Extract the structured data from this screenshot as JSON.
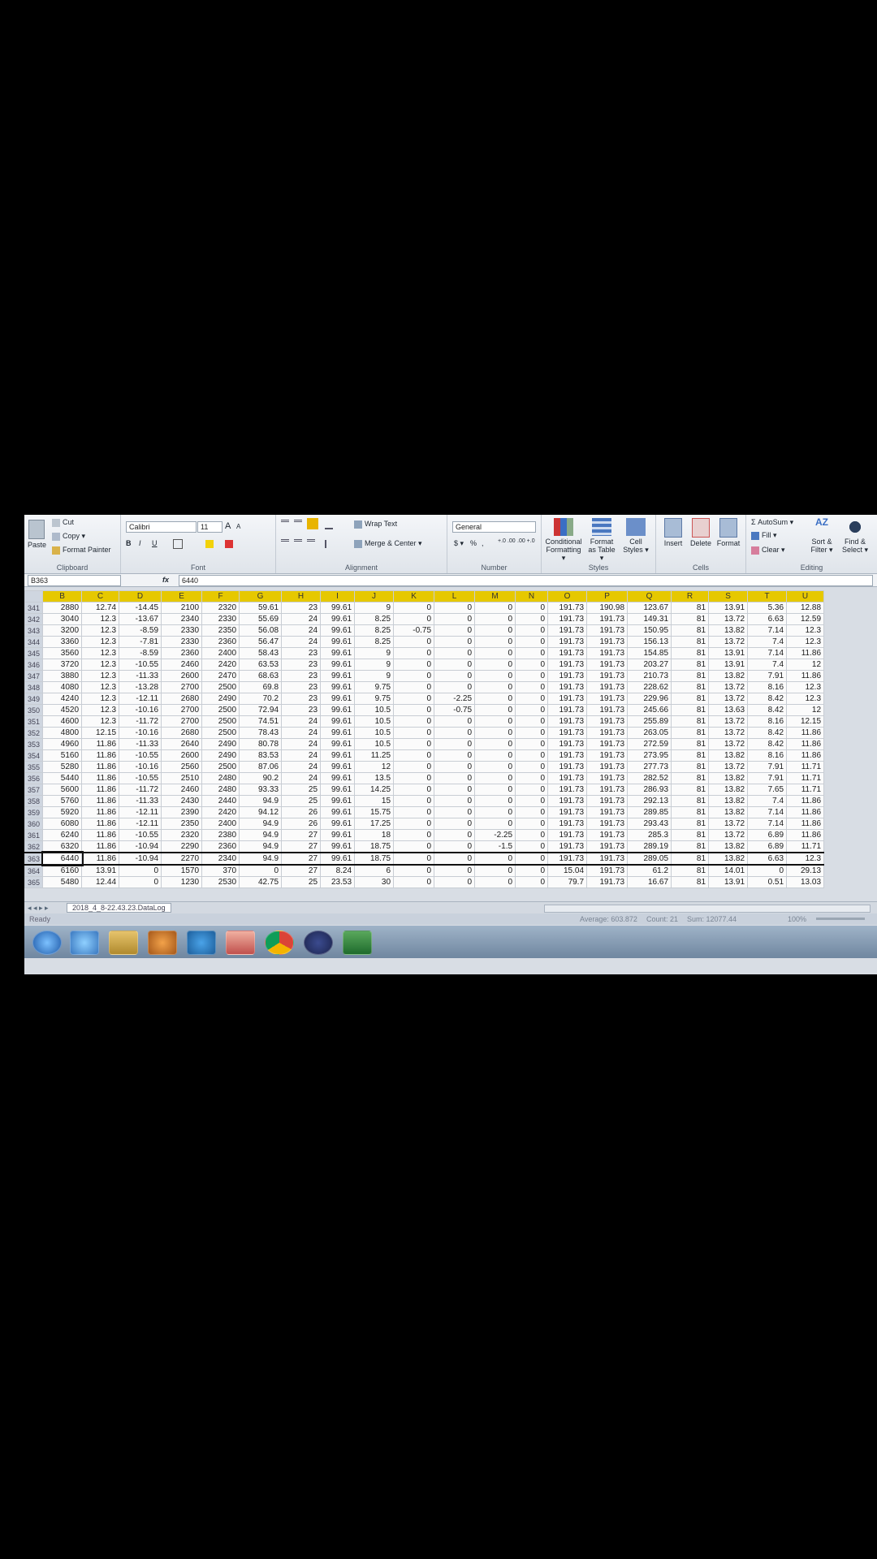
{
  "ribbon": {
    "clipboard": {
      "paste": "Paste",
      "cut": "Cut",
      "copy": "Copy ▾",
      "format_painter": "Format Painter",
      "label": "Clipboard"
    },
    "font": {
      "name": "Calibri",
      "size": "11",
      "grow": "A",
      "shrink": "A",
      "bold": "B",
      "italic": "I",
      "underline": "U",
      "label": "Font"
    },
    "alignment": {
      "wrap_text": "Wrap Text",
      "merge_center": "Merge & Center ▾",
      "label": "Alignment"
    },
    "number": {
      "format": "General",
      "currency": "$ ▾",
      "percent": "%",
      "comma": ",",
      "inc_decimal": "+.0 .00",
      "dec_decimal": ".00 +.0",
      "label": "Number"
    },
    "styles": {
      "conditional": "Conditional Formatting ▾",
      "format_table": "Format as Table ▾",
      "cell_styles": "Cell Styles ▾",
      "label": "Styles"
    },
    "cells": {
      "insert": "Insert",
      "delete": "Delete",
      "format": "Format",
      "label": "Cells"
    },
    "editing": {
      "autosum": "Σ AutoSum ▾",
      "fill": "Fill ▾",
      "clear": "Clear ▾",
      "sort_filter": "Sort & Filter ▾",
      "find_select": "Find & Select ▾",
      "label": "Editing"
    }
  },
  "formula_bar": {
    "name_box": "B363",
    "fx": "fx",
    "value": "6440"
  },
  "columns": [
    "B",
    "C",
    "D",
    "E",
    "F",
    "G",
    "H",
    "I",
    "J",
    "K",
    "L",
    "M",
    "N",
    "O",
    "P",
    "Q",
    "R",
    "S",
    "T",
    "U"
  ],
  "rows": [
    {
      "n": "341",
      "cells": [
        "2880",
        "12.74",
        "-14.45",
        "2100",
        "2320",
        "59.61",
        "23",
        "99.61",
        "9",
        "0",
        "0",
        "0",
        "0",
        "191.73",
        "190.98",
        "123.67",
        "81",
        "13.91",
        "5.36",
        "12.88"
      ]
    },
    {
      "n": "342",
      "cells": [
        "3040",
        "12.3",
        "-13.67",
        "2340",
        "2330",
        "55.69",
        "24",
        "99.61",
        "8.25",
        "0",
        "0",
        "0",
        "0",
        "191.73",
        "191.73",
        "149.31",
        "81",
        "13.72",
        "6.63",
        "12.59"
      ]
    },
    {
      "n": "343",
      "cells": [
        "3200",
        "12.3",
        "-8.59",
        "2330",
        "2350",
        "56.08",
        "24",
        "99.61",
        "8.25",
        "-0.75",
        "0",
        "0",
        "0",
        "191.73",
        "191.73",
        "150.95",
        "81",
        "13.82",
        "7.14",
        "12.3"
      ]
    },
    {
      "n": "344",
      "cells": [
        "3360",
        "12.3",
        "-7.81",
        "2330",
        "2360",
        "56.47",
        "24",
        "99.61",
        "8.25",
        "0",
        "0",
        "0",
        "0",
        "191.73",
        "191.73",
        "156.13",
        "81",
        "13.72",
        "7.4",
        "12.3"
      ]
    },
    {
      "n": "345",
      "cells": [
        "3560",
        "12.3",
        "-8.59",
        "2360",
        "2400",
        "58.43",
        "23",
        "99.61",
        "9",
        "0",
        "0",
        "0",
        "0",
        "191.73",
        "191.73",
        "154.85",
        "81",
        "13.91",
        "7.14",
        "11.86"
      ]
    },
    {
      "n": "346",
      "cells": [
        "3720",
        "12.3",
        "-10.55",
        "2460",
        "2420",
        "63.53",
        "23",
        "99.61",
        "9",
        "0",
        "0",
        "0",
        "0",
        "191.73",
        "191.73",
        "203.27",
        "81",
        "13.91",
        "7.4",
        "12"
      ]
    },
    {
      "n": "347",
      "cells": [
        "3880",
        "12.3",
        "-11.33",
        "2600",
        "2470",
        "68.63",
        "23",
        "99.61",
        "9",
        "0",
        "0",
        "0",
        "0",
        "191.73",
        "191.73",
        "210.73",
        "81",
        "13.82",
        "7.91",
        "11.86"
      ]
    },
    {
      "n": "348",
      "cells": [
        "4080",
        "12.3",
        "-13.28",
        "2700",
        "2500",
        "69.8",
        "23",
        "99.61",
        "9.75",
        "0",
        "0",
        "0",
        "0",
        "191.73",
        "191.73",
        "228.62",
        "81",
        "13.72",
        "8.16",
        "12.3"
      ]
    },
    {
      "n": "349",
      "cells": [
        "4240",
        "12.3",
        "-12.11",
        "2680",
        "2490",
        "70.2",
        "23",
        "99.61",
        "9.75",
        "0",
        "-2.25",
        "0",
        "0",
        "191.73",
        "191.73",
        "229.96",
        "81",
        "13.72",
        "8.42",
        "12.3"
      ]
    },
    {
      "n": "350",
      "cells": [
        "4520",
        "12.3",
        "-10.16",
        "2700",
        "2500",
        "72.94",
        "23",
        "99.61",
        "10.5",
        "0",
        "-0.75",
        "0",
        "0",
        "191.73",
        "191.73",
        "245.66",
        "81",
        "13.63",
        "8.42",
        "12"
      ]
    },
    {
      "n": "351",
      "cells": [
        "4600",
        "12.3",
        "-11.72",
        "2700",
        "2500",
        "74.51",
        "24",
        "99.61",
        "10.5",
        "0",
        "0",
        "0",
        "0",
        "191.73",
        "191.73",
        "255.89",
        "81",
        "13.72",
        "8.16",
        "12.15"
      ]
    },
    {
      "n": "352",
      "cells": [
        "4800",
        "12.15",
        "-10.16",
        "2680",
        "2500",
        "78.43",
        "24",
        "99.61",
        "10.5",
        "0",
        "0",
        "0",
        "0",
        "191.73",
        "191.73",
        "263.05",
        "81",
        "13.72",
        "8.42",
        "11.86"
      ]
    },
    {
      "n": "353",
      "cells": [
        "4960",
        "11.86",
        "-11.33",
        "2640",
        "2490",
        "80.78",
        "24",
        "99.61",
        "10.5",
        "0",
        "0",
        "0",
        "0",
        "191.73",
        "191.73",
        "272.59",
        "81",
        "13.72",
        "8.42",
        "11.86"
      ]
    },
    {
      "n": "354",
      "cells": [
        "5160",
        "11.86",
        "-10.55",
        "2600",
        "2490",
        "83.53",
        "24",
        "99.61",
        "11.25",
        "0",
        "0",
        "0",
        "0",
        "191.73",
        "191.73",
        "273.95",
        "81",
        "13.82",
        "8.16",
        "11.86"
      ]
    },
    {
      "n": "355",
      "cells": [
        "5280",
        "11.86",
        "-10.16",
        "2560",
        "2500",
        "87.06",
        "24",
        "99.61",
        "12",
        "0",
        "0",
        "0",
        "0",
        "191.73",
        "191.73",
        "277.73",
        "81",
        "13.72",
        "7.91",
        "11.71"
      ]
    },
    {
      "n": "356",
      "cells": [
        "5440",
        "11.86",
        "-10.55",
        "2510",
        "2480",
        "90.2",
        "24",
        "99.61",
        "13.5",
        "0",
        "0",
        "0",
        "0",
        "191.73",
        "191.73",
        "282.52",
        "81",
        "13.82",
        "7.91",
        "11.71"
      ]
    },
    {
      "n": "357",
      "cells": [
        "5600",
        "11.86",
        "-11.72",
        "2460",
        "2480",
        "93.33",
        "25",
        "99.61",
        "14.25",
        "0",
        "0",
        "0",
        "0",
        "191.73",
        "191.73",
        "286.93",
        "81",
        "13.82",
        "7.65",
        "11.71"
      ]
    },
    {
      "n": "358",
      "cells": [
        "5760",
        "11.86",
        "-11.33",
        "2430",
        "2440",
        "94.9",
        "25",
        "99.61",
        "15",
        "0",
        "0",
        "0",
        "0",
        "191.73",
        "191.73",
        "292.13",
        "81",
        "13.82",
        "7.4",
        "11.86"
      ]
    },
    {
      "n": "359",
      "cells": [
        "5920",
        "11.86",
        "-12.11",
        "2390",
        "2420",
        "94.12",
        "26",
        "99.61",
        "15.75",
        "0",
        "0",
        "0",
        "0",
        "191.73",
        "191.73",
        "289.85",
        "81",
        "13.82",
        "7.14",
        "11.86"
      ]
    },
    {
      "n": "360",
      "cells": [
        "6080",
        "11.86",
        "-12.11",
        "2350",
        "2400",
        "94.9",
        "26",
        "99.61",
        "17.25",
        "0",
        "0",
        "0",
        "0",
        "191.73",
        "191.73",
        "293.43",
        "81",
        "13.72",
        "7.14",
        "11.86"
      ]
    },
    {
      "n": "361",
      "cells": [
        "6240",
        "11.86",
        "-10.55",
        "2320",
        "2380",
        "94.9",
        "27",
        "99.61",
        "18",
        "0",
        "0",
        "-2.25",
        "0",
        "191.73",
        "191.73",
        "285.3",
        "81",
        "13.72",
        "6.89",
        "11.86"
      ]
    },
    {
      "n": "362",
      "cells": [
        "6320",
        "11.86",
        "-10.94",
        "2290",
        "2360",
        "94.9",
        "27",
        "99.61",
        "18.75",
        "0",
        "0",
        "-1.5",
        "0",
        "191.73",
        "191.73",
        "289.19",
        "81",
        "13.82",
        "6.89",
        "11.71"
      ]
    },
    {
      "n": "363",
      "cells": [
        "6440",
        "11.86",
        "-10.94",
        "2270",
        "2340",
        "94.9",
        "27",
        "99.61",
        "18.75",
        "0",
        "0",
        "0",
        "0",
        "191.73",
        "191.73",
        "289.05",
        "81",
        "13.82",
        "6.63",
        "12.3"
      ]
    },
    {
      "n": "364",
      "cells": [
        "6160",
        "13.91",
        "0",
        "1570",
        "370",
        "0",
        "27",
        "8.24",
        "6",
        "0",
        "0",
        "0",
        "0",
        "15.04",
        "191.73",
        "61.2",
        "81",
        "14.01",
        "0",
        "29.13"
      ]
    },
    {
      "n": "365",
      "cells": [
        "5480",
        "12.44",
        "0",
        "1230",
        "2530",
        "42.75",
        "25",
        "23.53",
        "30",
        "0",
        "0",
        "0",
        "0",
        "79.7",
        "191.73",
        "16.67",
        "81",
        "13.91",
        "0.51",
        "13.03"
      ]
    }
  ],
  "sheet_tab": "2018_4_8-22.43.23.DataLog",
  "status": {
    "ready": "Ready",
    "average": "Average: 603.872",
    "count": "Count: 21",
    "sum": "Sum: 12077.44",
    "zoom": "100%"
  },
  "taskbar": {
    "apps": [
      "start-orb-icon",
      "ie-icon",
      "explorer-icon",
      "media-player-icon",
      "hp-icon",
      "folder-icon",
      "chrome-icon",
      "app-icon",
      "excel-icon"
    ]
  }
}
